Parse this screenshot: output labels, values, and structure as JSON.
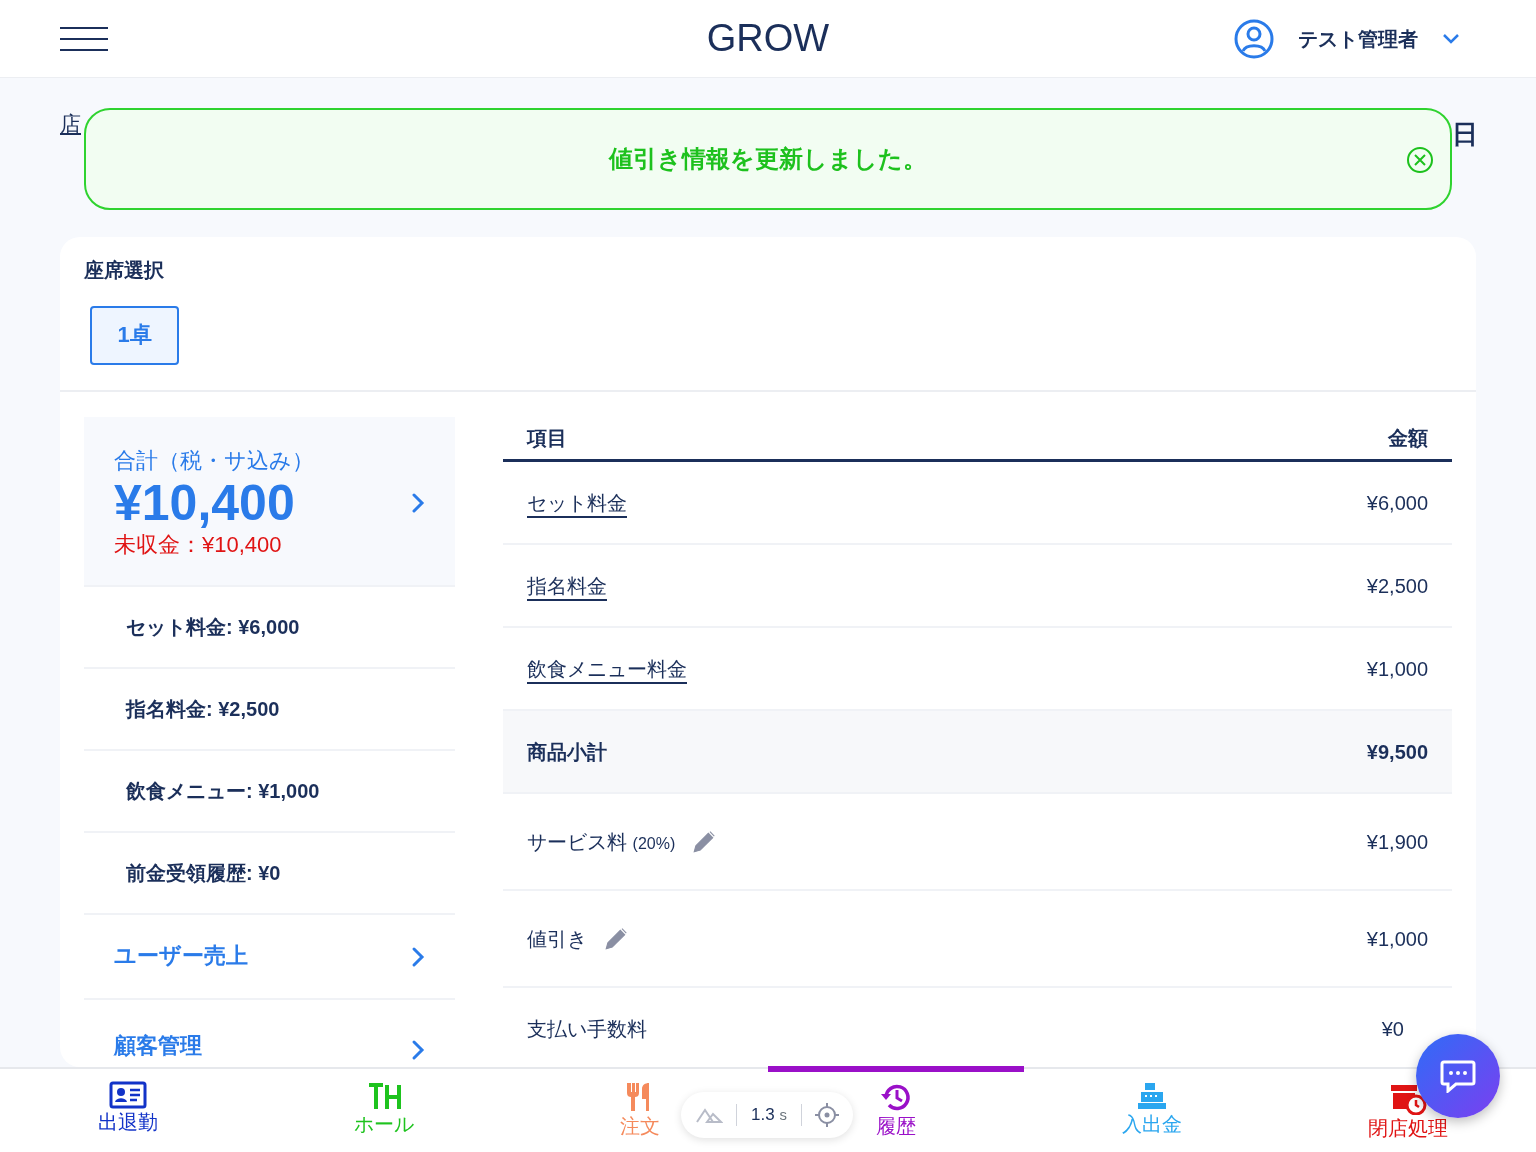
{
  "header": {
    "title": "GROW",
    "user": "テスト管理者"
  },
  "breadcrumb": "店",
  "date_fragment": "日",
  "toast": {
    "message": "値引き情報を更新しました。"
  },
  "seat_selection": {
    "label": "座席選択",
    "seats": [
      {
        "label": "1卓",
        "selected": true
      }
    ]
  },
  "summary": {
    "total_label": "合計（税・サ込み）",
    "total": "¥10,400",
    "unpaid": "未収金：¥10,400",
    "items": [
      {
        "kind": "info",
        "text": "セット料金: ¥6,000"
      },
      {
        "kind": "info",
        "text": "指名料金: ¥2,500"
      },
      {
        "kind": "info",
        "text": "飲食メニュー: ¥1,000"
      },
      {
        "kind": "info",
        "text": "前金受領履歴: ¥0"
      },
      {
        "kind": "link",
        "text": "ユーザー売上"
      },
      {
        "kind": "link",
        "text": "顧客管理"
      }
    ]
  },
  "table": {
    "columns": [
      "項目",
      "金額"
    ],
    "rows": [
      {
        "kind": "link",
        "name": "セット料金",
        "amount": "¥6,000"
      },
      {
        "kind": "link",
        "name": "指名料金",
        "amount": "¥2,500"
      },
      {
        "kind": "link",
        "name": "飲食メニュー料金",
        "amount": "¥1,000"
      },
      {
        "kind": "subtotal",
        "name": "商品小計",
        "amount": "¥9,500"
      },
      {
        "kind": "editable",
        "name": "サービス料",
        "rate": "(20%)",
        "amount": "¥1,900"
      },
      {
        "kind": "editable",
        "name": "値引き",
        "amount": "¥1,000"
      },
      {
        "kind": "plain",
        "name": "支払い手数料",
        "amount": "¥0"
      }
    ]
  },
  "bottom_nav": [
    {
      "label": "出退勤",
      "color": "#1233c8",
      "selected": false
    },
    {
      "label": "ホール",
      "color": "#1ec31e",
      "selected": false
    },
    {
      "label": "注文",
      "color": "#f58a5c",
      "selected": false
    },
    {
      "label": "履歴",
      "color": "#9a10c8",
      "selected": true
    },
    {
      "label": "入出金",
      "color": "#2aa6ef",
      "selected": false
    },
    {
      "label": "閉店処理",
      "color": "#e01414",
      "selected": false
    }
  ],
  "perf_badge": {
    "value": "1.3",
    "unit": "s"
  }
}
